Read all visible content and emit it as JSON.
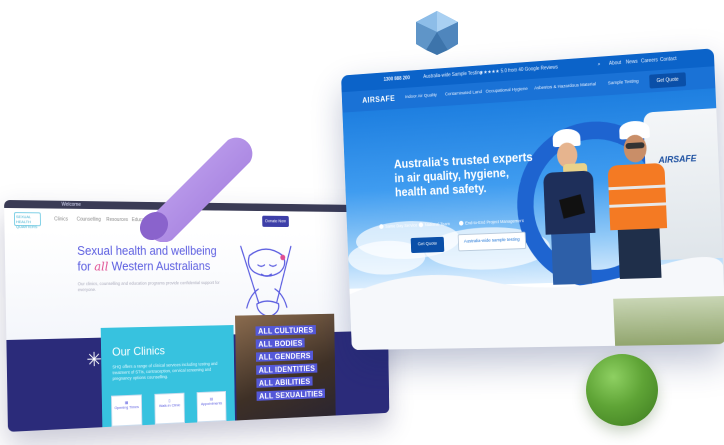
{
  "left_site": {
    "topbar_text": "Welcome",
    "logo_text": "SEXUAL HEALTH QUARTERS",
    "nav_links": [
      "Clinics",
      "Counselling",
      "Resources",
      "Education"
    ],
    "nav_button": "Donate Now",
    "hero_title_line1": "Sexual health and wellbeing",
    "hero_title_for": "for",
    "hero_title_all": "all",
    "hero_title_rest": "Western Australians",
    "hero_sub": "Our clinics, counselling and education programs provide confidential support for everyone.",
    "clinics_title": "Our Clinics",
    "clinics_text": "SHQ offers a range of clinical services including testing and treatment of STIs, contraception, cervical screening and pregnancy options counselling.",
    "mini_cards": [
      "Opening Times",
      "Walk-in Clinic",
      "Appointments"
    ],
    "all_lines": [
      "ALL CULTURES",
      "ALL BODIES",
      "ALL GENDERS",
      "ALL IDENTITIES",
      "ALL ABILITIES",
      "ALL SEXUALITIES"
    ]
  },
  "right_site": {
    "topbar_phone": "1300 888 200",
    "topbar_accred": "Australia-wide Sample Testing",
    "topbar_reviews": "★★★★★ 5.0 from 40 Google Reviews",
    "topbar_links": [
      "About",
      "News",
      "Careers",
      "Contact"
    ],
    "logo": "AIRSAFE",
    "nav_links": [
      "Indoor Air Quality",
      "Contaminated Land",
      "Occupational Hygiene",
      "Asbestos & Hazardous Material",
      "Sample Testing"
    ],
    "nav_button": "Get Quote",
    "hero_title": "Australia's trusted experts in air quality, hygiene, health and safety.",
    "pills": [
      "Same Day Service",
      "National Team",
      "End-to-End Project Management"
    ],
    "btn_primary": "Get Quote",
    "btn_secondary": "Australia-wide sample testing",
    "van_logo": "AIRSAFE"
  },
  "colors": {
    "brand_blue": "#1a72d6",
    "left_purple": "#5458d8",
    "left_teal": "#37c2df",
    "sphere_green": "#5fa436",
    "cylinder_purple": "#b18ee6",
    "crystal_blue": "#6ea7d8"
  }
}
